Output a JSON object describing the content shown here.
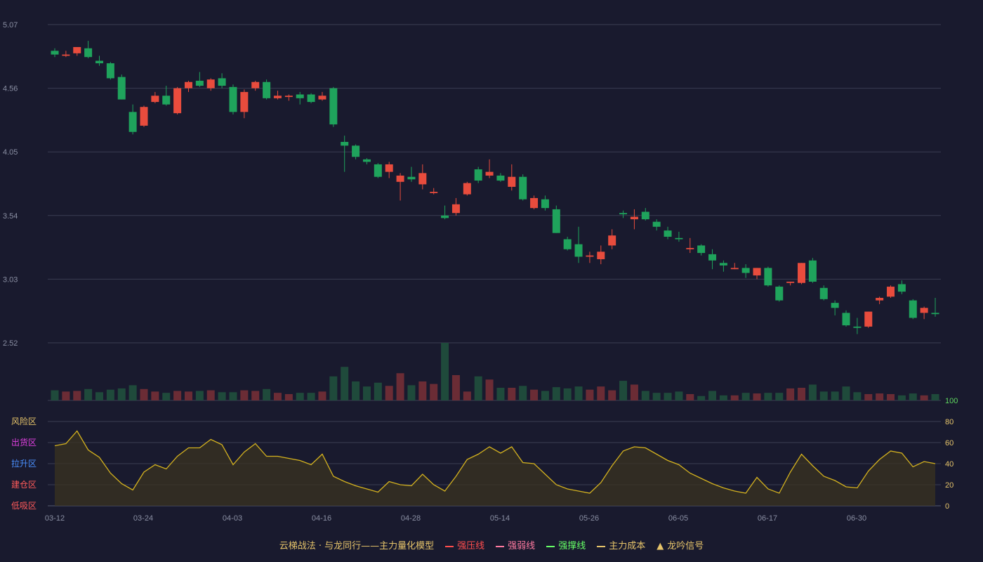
{
  "chart_data": {
    "type": "candlestick",
    "x_ticks": [
      "03-12",
      "03-24",
      "04-03",
      "04-16",
      "04-28",
      "05-14",
      "05-26",
      "06-05",
      "06-17",
      "06-30"
    ],
    "price_axis": {
      "ticks": [
        "2.52",
        "3.03",
        "3.54",
        "4.05",
        "4.56",
        "5.07"
      ],
      "range": [
        2.52,
        5.07
      ]
    },
    "oscillator_axis": {
      "ticks": [
        "0",
        "20",
        "40",
        "60",
        "80",
        "100"
      ],
      "range": [
        0,
        100
      ]
    },
    "zones": [
      {
        "label": "风险区",
        "level": 80,
        "color": "#e6c46a"
      },
      {
        "label": "出货区",
        "level": 60,
        "color": "#e040e0"
      },
      {
        "label": "拉升区",
        "level": 40,
        "color": "#4a90ff"
      },
      {
        "label": "建仓区",
        "level": 20,
        "color": "#ff5a5a"
      },
      {
        "label": "低吸区",
        "level": 0,
        "color": "#ff5a5a"
      }
    ],
    "candles": [
      [
        4.86,
        4.83,
        4.88,
        4.81
      ],
      [
        4.82,
        4.83,
        4.86,
        4.81
      ],
      [
        4.84,
        4.89,
        4.89,
        4.82
      ],
      [
        4.88,
        4.81,
        4.94,
        4.8
      ],
      [
        4.78,
        4.76,
        4.82,
        4.74
      ],
      [
        4.76,
        4.64,
        4.77,
        4.63
      ],
      [
        4.65,
        4.47,
        4.67,
        4.47
      ],
      [
        4.37,
        4.21,
        4.43,
        4.19
      ],
      [
        4.26,
        4.41,
        4.42,
        4.25
      ],
      [
        4.45,
        4.5,
        4.53,
        4.44
      ],
      [
        4.5,
        4.43,
        4.58,
        4.42
      ],
      [
        4.36,
        4.56,
        4.57,
        4.35
      ],
      [
        4.56,
        4.61,
        4.62,
        4.53
      ],
      [
        4.62,
        4.58,
        4.69,
        4.57
      ],
      [
        4.56,
        4.63,
        4.64,
        4.54
      ],
      [
        4.64,
        4.58,
        4.68,
        4.56
      ],
      [
        4.57,
        4.37,
        4.59,
        4.35
      ],
      [
        4.37,
        4.53,
        4.55,
        4.32
      ],
      [
        4.56,
        4.61,
        4.62,
        4.54
      ],
      [
        4.61,
        4.48,
        4.63,
        4.47
      ],
      [
        4.48,
        4.5,
        4.54,
        4.47
      ],
      [
        4.49,
        4.5,
        4.51,
        4.46
      ],
      [
        4.51,
        4.48,
        4.53,
        4.43
      ],
      [
        4.51,
        4.45,
        4.52,
        4.44
      ],
      [
        4.47,
        4.5,
        4.53,
        4.46
      ],
      [
        4.56,
        4.27,
        4.57,
        4.25
      ],
      [
        4.13,
        4.1,
        4.18,
        3.89
      ],
      [
        4.1,
        4.01,
        4.11,
        3.99
      ],
      [
        3.99,
        3.97,
        4.0,
        3.95
      ],
      [
        3.95,
        3.85,
        3.96,
        3.84
      ],
      [
        3.89,
        3.95,
        3.97,
        3.84
      ],
      [
        3.81,
        3.86,
        3.88,
        3.66
      ],
      [
        3.85,
        3.83,
        3.93,
        3.81
      ],
      [
        3.79,
        3.88,
        3.95,
        3.75
      ],
      [
        3.72,
        3.73,
        3.76,
        3.71
      ],
      [
        3.54,
        3.52,
        3.62,
        3.51
      ],
      [
        3.56,
        3.63,
        3.68,
        3.54
      ],
      [
        3.71,
        3.8,
        3.81,
        3.7
      ],
      [
        3.91,
        3.82,
        3.93,
        3.8
      ],
      [
        3.86,
        3.89,
        3.99,
        3.84
      ],
      [
        3.86,
        3.82,
        3.88,
        3.81
      ],
      [
        3.77,
        3.85,
        3.95,
        3.74
      ],
      [
        3.85,
        3.67,
        3.87,
        3.66
      ],
      [
        3.6,
        3.68,
        3.7,
        3.59
      ],
      [
        3.67,
        3.6,
        3.7,
        3.58
      ],
      [
        3.59,
        3.4,
        3.62,
        3.4
      ],
      [
        3.35,
        3.27,
        3.37,
        3.26
      ],
      [
        3.31,
        3.21,
        3.45,
        3.16
      ],
      [
        3.21,
        3.22,
        3.25,
        3.16
      ],
      [
        3.19,
        3.25,
        3.3,
        3.15
      ],
      [
        3.3,
        3.38,
        3.43,
        3.27
      ],
      [
        3.56,
        3.55,
        3.58,
        3.52
      ],
      [
        3.51,
        3.53,
        3.59,
        3.43
      ],
      [
        3.57,
        3.51,
        3.6,
        3.5
      ],
      [
        3.49,
        3.45,
        3.51,
        3.42
      ],
      [
        3.42,
        3.37,
        3.45,
        3.35
      ],
      [
        3.36,
        3.35,
        3.41,
        3.33
      ],
      [
        3.27,
        3.28,
        3.36,
        3.24
      ],
      [
        3.3,
        3.24,
        3.31,
        3.22
      ],
      [
        3.23,
        3.18,
        3.27,
        3.11
      ],
      [
        3.16,
        3.14,
        3.18,
        3.09
      ],
      [
        3.11,
        3.12,
        3.16,
        3.11
      ],
      [
        3.12,
        3.08,
        3.15,
        3.04
      ],
      [
        3.06,
        3.12,
        3.12,
        3.03
      ],
      [
        3.12,
        2.98,
        3.13,
        2.97
      ],
      [
        2.97,
        2.86,
        2.98,
        2.85
      ],
      [
        3.0,
        3.01,
        3.01,
        2.98
      ],
      [
        3.0,
        3.16,
        3.16,
        2.99
      ],
      [
        3.18,
        3.01,
        3.2,
        3.0
      ],
      [
        2.96,
        2.87,
        2.98,
        2.86
      ],
      [
        2.84,
        2.8,
        2.86,
        2.74
      ],
      [
        2.76,
        2.66,
        2.78,
        2.65
      ],
      [
        2.65,
        2.64,
        2.72,
        2.59
      ],
      [
        2.65,
        2.77,
        2.77,
        2.64
      ],
      [
        2.86,
        2.88,
        2.89,
        2.83
      ],
      [
        2.89,
        2.97,
        2.98,
        2.88
      ],
      [
        2.99,
        2.93,
        3.02,
        2.91
      ],
      [
        2.86,
        2.72,
        2.87,
        2.71
      ],
      [
        2.76,
        2.8,
        2.81,
        2.71
      ],
      [
        2.76,
        2.75,
        2.88,
        2.73
      ]
    ],
    "volume": [
      16,
      14,
      15,
      18,
      13,
      17,
      19,
      24,
      18,
      14,
      12,
      15,
      14,
      15,
      16,
      13,
      13,
      16,
      15,
      18,
      12,
      10,
      12,
      12,
      14,
      38,
      53,
      30,
      22,
      28,
      23,
      43,
      24,
      30,
      26,
      91,
      40,
      14,
      38,
      33,
      20,
      20,
      23,
      17,
      15,
      21,
      19,
      22,
      17,
      22,
      16,
      31,
      25,
      15,
      12,
      12,
      14,
      10,
      7,
      15,
      8,
      8,
      12,
      11,
      12,
      12,
      19,
      20,
      25,
      14,
      14,
      22,
      13,
      10,
      11,
      10,
      8,
      11,
      8,
      10
    ],
    "oscillator": [
      57,
      59,
      71,
      53,
      46,
      31,
      21,
      15,
      32,
      39,
      35,
      47,
      55,
      55,
      63,
      58,
      39,
      51,
      59,
      47,
      47,
      45,
      43,
      39,
      49,
      28,
      23,
      19,
      16,
      13,
      23,
      20,
      19,
      30,
      20,
      14,
      28,
      44,
      49,
      56,
      50,
      56,
      41,
      40,
      30,
      20,
      16,
      14,
      12,
      22,
      38,
      52,
      56,
      55,
      49,
      43,
      39,
      31,
      26,
      21,
      17,
      14,
      12,
      27,
      16,
      12,
      32,
      49,
      38,
      28,
      24,
      18,
      17,
      33,
      44,
      52,
      50,
      37,
      42,
      40
    ],
    "legend": [
      {
        "label": "云梯战法 · 与龙同行——主力量化模型",
        "kind": "text",
        "color": "#e6c46a"
      },
      {
        "label": "强压线",
        "kind": "solid",
        "color": "#ff4d4d"
      },
      {
        "label": "强弱线",
        "kind": "dashed",
        "color": "#ff7aa0"
      },
      {
        "label": "强撑线",
        "kind": "solid",
        "color": "#66ff66"
      },
      {
        "label": "主力成本",
        "kind": "dashed",
        "color": "#e6c46a"
      },
      {
        "label": "龙吟信号",
        "kind": "triangle",
        "color": "#e6c46a"
      }
    ],
    "colors": {
      "up": "#e84c3d",
      "down": "#1fa35c",
      "vol_up": "#6b2c35",
      "vol_down": "#1f4a3b",
      "line": "#d4b21f",
      "axis_right": "#e6c46a",
      "hundred": "#5fd75f"
    }
  }
}
